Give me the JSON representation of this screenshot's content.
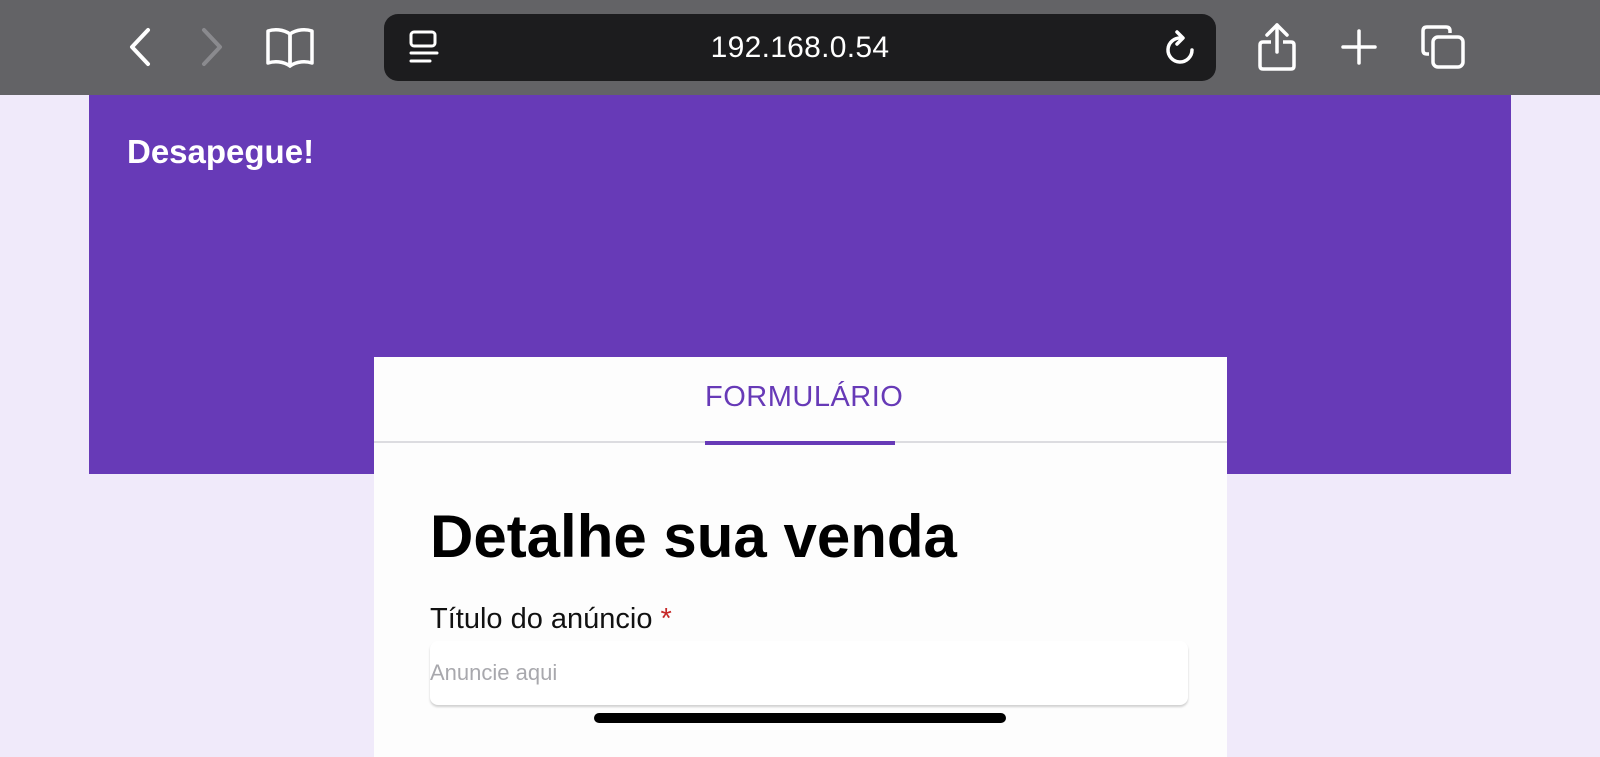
{
  "browser": {
    "url": "192.168.0.54",
    "icons": {
      "back": "chevron-left-icon",
      "forward": "chevron-right-icon",
      "bookmarks": "book-icon",
      "reader": "reader-icon",
      "reload": "reload-icon",
      "share": "share-icon",
      "new_tab": "plus-icon",
      "tabs": "tabs-icon"
    },
    "forward_enabled": false
  },
  "header": {
    "brand": "Desapegue!"
  },
  "card": {
    "tab_label": "FORMULÁRIO",
    "title": "Detalhe sua venda",
    "fields": [
      {
        "label": "Título do anúncio",
        "required_mark": "*",
        "placeholder": "Anuncie aqui",
        "value": ""
      }
    ]
  },
  "colors": {
    "primary": "#673ab7",
    "page_background": "#f0eafa",
    "toolbar": "#636366",
    "address_bar": "#1c1c1e",
    "required": "#c62828"
  }
}
